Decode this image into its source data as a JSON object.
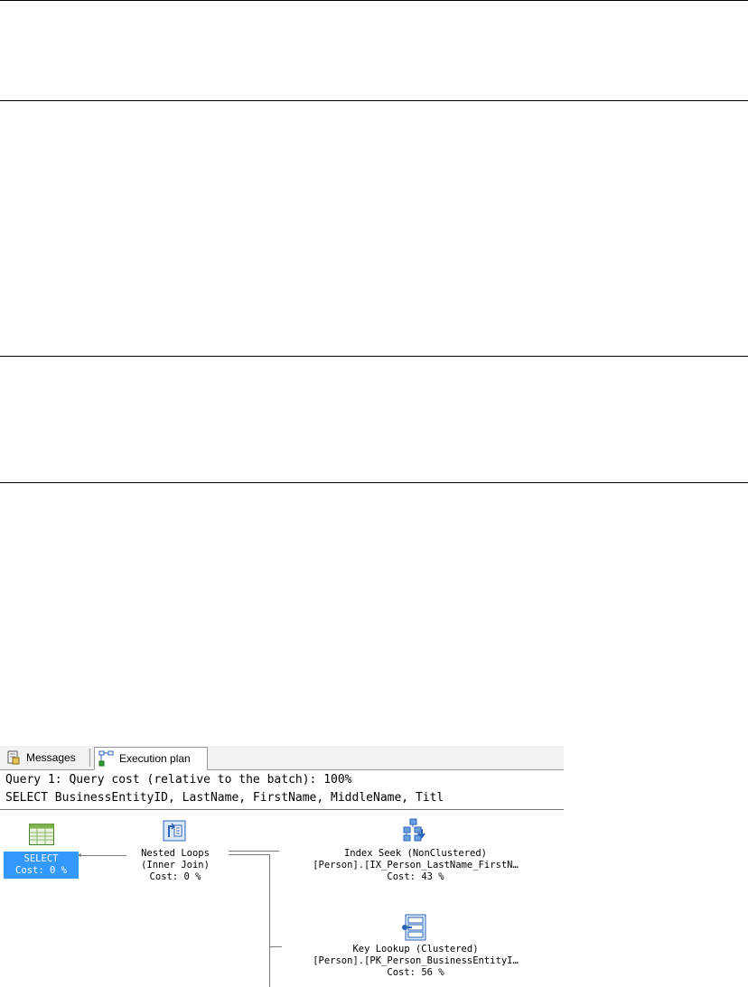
{
  "results_panel": {
    "tabs": [
      {
        "label": "Messages",
        "icon": "messages-icon"
      },
      {
        "label": "Execution plan",
        "icon": "execution-plan-icon"
      }
    ],
    "query_header": "Query 1: Query cost (relative to the batch): 100%",
    "query_text": "SELECT BusinessEntityID, LastName, FirstName, MiddleName, Titl"
  },
  "plan": {
    "select": {
      "label": "SELECT",
      "cost": "Cost: 0 %",
      "icon": "result-grid-icon",
      "highlight": "#3399ff"
    },
    "nested_loops": {
      "label": "Nested Loops",
      "detail": "(Inner Join)",
      "cost": "Cost: 0 %",
      "icon": "nested-loops-icon"
    },
    "index_seek": {
      "label": "Index Seek (NonClustered)",
      "detail": "[Person].[IX_Person_LastName_FirstN…",
      "cost": "Cost: 43 %",
      "icon": "index-seek-icon"
    },
    "key_lookup": {
      "label": "Key Lookup (Clustered)",
      "detail": "[Person].[PK_Person_BusinessEntityI…",
      "cost": "Cost: 56 %",
      "icon": "key-lookup-icon"
    }
  }
}
